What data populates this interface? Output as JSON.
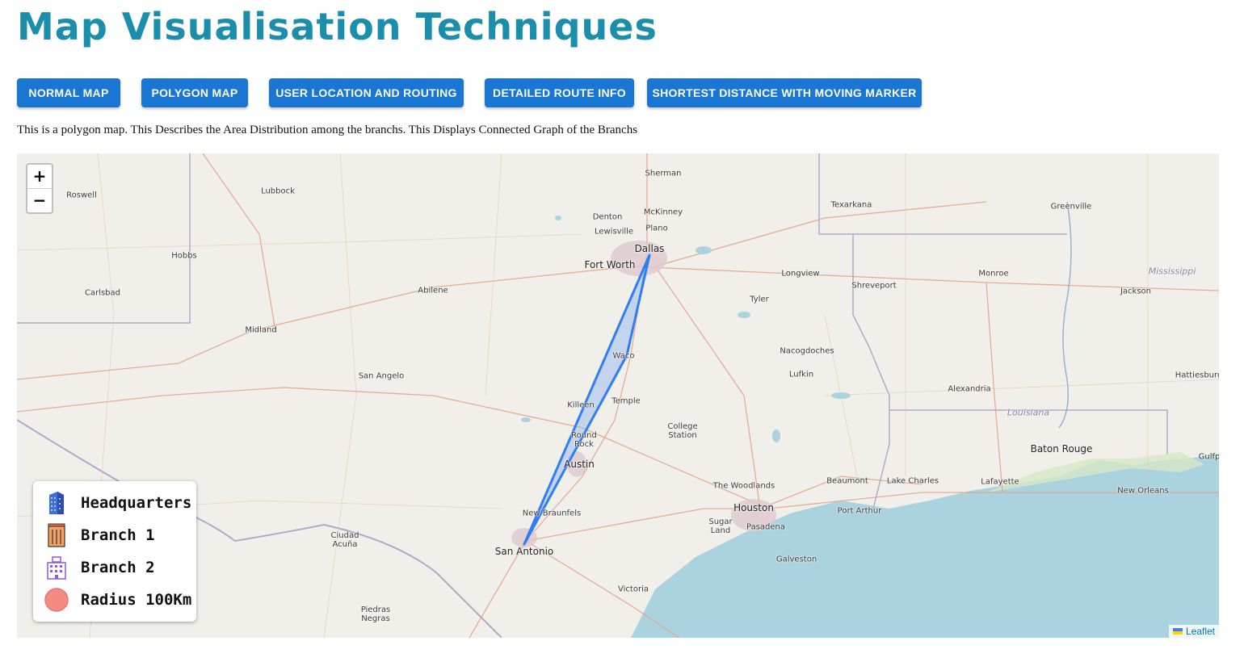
{
  "page": {
    "title": "Map Visualisation Techniques",
    "description": "This is a polygon map. This Describes the Area Distribution among the branchs. This Displays Connected Graph of the Branchs"
  },
  "nav": {
    "buttons": [
      {
        "label": "NORMAL MAP"
      },
      {
        "label": "POLYGON MAP"
      },
      {
        "label": "USER LOCATION AND ROUTING"
      },
      {
        "label": "DETAILED ROUTE INFO"
      },
      {
        "label": "SHORTEST DISTANCE WITH MOVING MARKER"
      }
    ]
  },
  "map": {
    "zoom_in": "+",
    "zoom_out": "−",
    "attribution": "Leaflet",
    "cities": [
      "Sherman",
      "Roswell",
      "Lubbock",
      "Texarkana",
      "Greenville",
      "Denton",
      "McKinney",
      "Lewisville",
      "Plano",
      "Dallas",
      "Fort Worth",
      "Hobbs",
      "Carlsbad",
      "Abilene",
      "Longview",
      "Shreveport",
      "Monroe",
      "Mississippi",
      "Jackson",
      "Tyler",
      "Midland",
      "Waco",
      "Nacogdoches",
      "San Angelo",
      "Lufkin",
      "Hattiesburg",
      "Alexandria",
      "Killeen",
      "Temple",
      "Louisiana",
      "College Station",
      "Round Rock",
      "Baton Rouge",
      "Austin",
      "Gulfp",
      "The Woodlands",
      "Beaumont",
      "Lake Charles",
      "Lafayette",
      "New Orleans",
      "New Braunfels",
      "Houston",
      "Port Arthur",
      "Ciudad Acuña",
      "Sugar Land",
      "Pasadena",
      "San Antonio",
      "Galveston",
      "Victoria",
      "Piedras Negras"
    ],
    "polygon_color": "#2f7ef3",
    "polygon_fill": "#8fb3ef"
  },
  "legend": {
    "items": [
      {
        "label": "Headquarters",
        "icon": "headquarters-building-icon"
      },
      {
        "label": "Branch 1",
        "icon": "branch1-building-icon"
      },
      {
        "label": "Branch 2",
        "icon": "branch2-building-icon"
      },
      {
        "label": "Radius 100Km",
        "icon": "radius-circle-icon"
      }
    ]
  },
  "colors": {
    "title": "#1b8eac",
    "button": "#1976d2",
    "water": "#aad3df",
    "land": "#f1efe9",
    "radius": "#f28b82"
  }
}
